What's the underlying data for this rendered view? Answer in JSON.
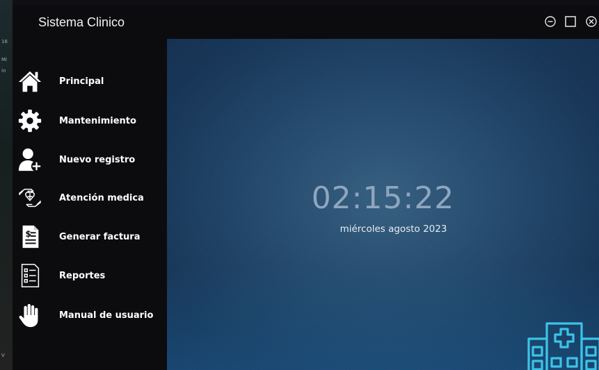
{
  "window": {
    "title": "Sistema Clinico"
  },
  "desktop_strip": [
    "16",
    "Mi",
    "in",
    "V"
  ],
  "window_controls": [
    "minimize",
    "maximize",
    "close"
  ],
  "sidebar": {
    "items": [
      {
        "label": "Principal",
        "icon": "home-icon"
      },
      {
        "label": "Mantenimiento",
        "icon": "gear-icon"
      },
      {
        "label": "Nuevo registro",
        "icon": "add-user-icon"
      },
      {
        "label": "Atención medica",
        "icon": "medical-care-icon"
      },
      {
        "label": "Generar factura",
        "icon": "invoice-icon"
      },
      {
        "label": "Reportes",
        "icon": "report-icon"
      },
      {
        "label": "Manual de usuario",
        "icon": "hand-icon"
      }
    ]
  },
  "main": {
    "time": "02:15:22",
    "date": "miércoles agosto 2023",
    "accent_color": "#3cc3e8"
  }
}
